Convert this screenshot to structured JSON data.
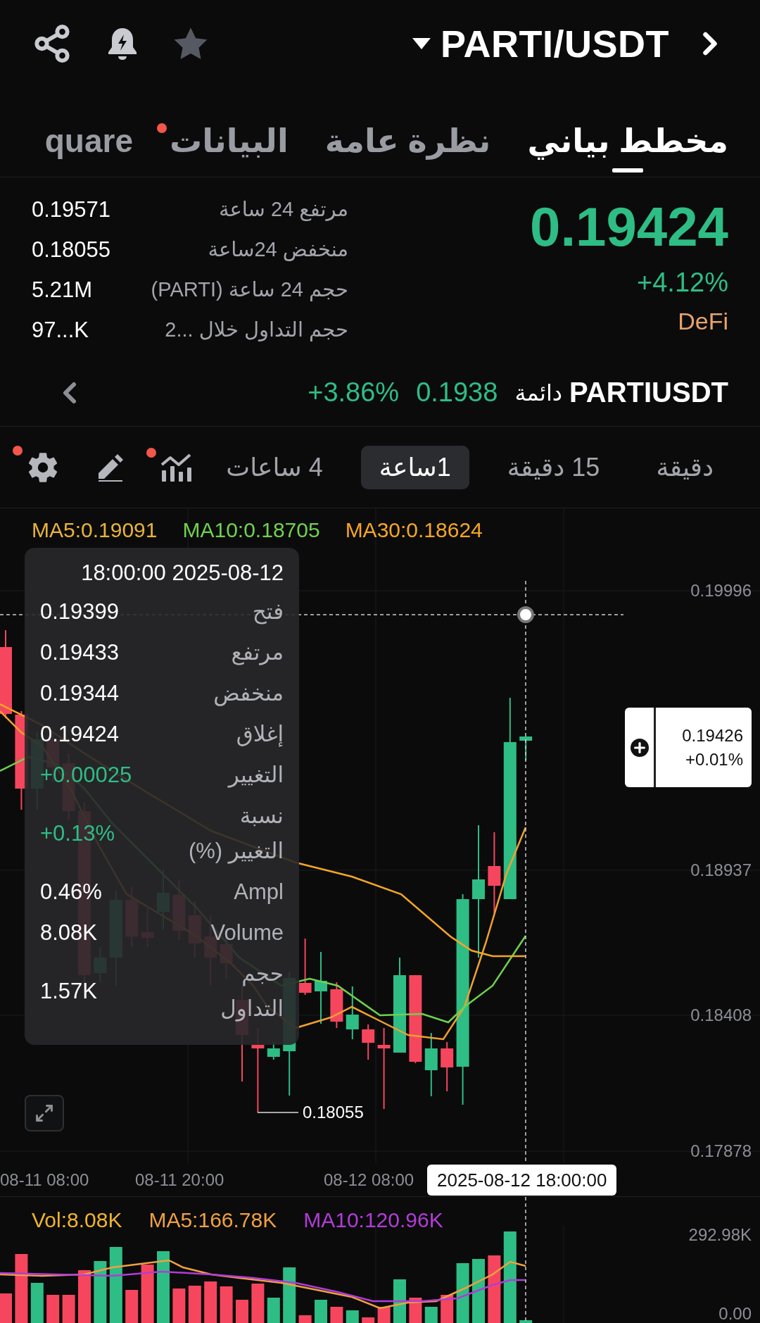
{
  "header": {
    "pair": "PARTI/USDT"
  },
  "tabs": [
    {
      "label": "مخطط بياني",
      "selected": true,
      "dot": false
    },
    {
      "label": "نظرة عامة",
      "selected": false,
      "dot": false
    },
    {
      "label": "البيانات",
      "selected": false,
      "dot": true
    },
    {
      "label": "quare",
      "selected": false,
      "dot": false
    }
  ],
  "price": {
    "last": "0.19424",
    "change": "+4.12%",
    "sector": "DeFi"
  },
  "stats": [
    {
      "label": "مرتفع 24 ساعة",
      "value": "0.19571"
    },
    {
      "label": "منخفض 24ساعة",
      "value": "0.18055"
    },
    {
      "label": "حجم 24 ساعة (PARTI)",
      "value": "5.21M"
    },
    {
      "label": "حجم التداول خلال ...2",
      "value": "97...K"
    }
  ],
  "perpetual": {
    "symbol": "PARTIUSDT",
    "type": "دائمة",
    "price": "0.1938",
    "change": "+3.86%"
  },
  "timeframes": [
    {
      "label": "دقيقة",
      "selected": false
    },
    {
      "label": "15 دقيقة",
      "selected": false
    },
    {
      "label": "1ساعة",
      "selected": true
    },
    {
      "label": "4 ساعات",
      "selected": false
    }
  ],
  "tools": [
    {
      "kind": "indicators",
      "dot": true
    },
    {
      "kind": "draw",
      "dot": false
    },
    {
      "kind": "settings",
      "dot": true
    }
  ],
  "chart": {
    "legend": [
      {
        "text": "MA30:0.18624",
        "color": "#f5a623"
      },
      {
        "text": "MA10:0.18705",
        "color": "#6fd14f"
      },
      {
        "text": "MA5:0.19091",
        "color": "#e8b33a"
      }
    ],
    "price_axis": [
      "0.19996",
      "0.18937",
      "0.18408",
      "0.17878"
    ],
    "low_marker": "0.18055",
    "crosshair": {
      "price": "0.19426",
      "change": "+0.01%",
      "time": "2025-08-12 18:00:00"
    },
    "time_axis": [
      "08-12 08:00",
      "08-11 20:00",
      "08-11 08:00"
    ],
    "tooltip": {
      "title": "18:00:00 2025-08-12",
      "rows": [
        {
          "label": "فتح",
          "value": "0.19399",
          "kind": "plain"
        },
        {
          "label": "مرتفع",
          "value": "0.19433",
          "kind": "plain"
        },
        {
          "label": "منخفض",
          "value": "0.19344",
          "kind": "plain"
        },
        {
          "label": "إغلاق",
          "value": "0.19424",
          "kind": "plain"
        },
        {
          "label": "التغيير",
          "value": "+0.00025",
          "kind": "change"
        },
        {
          "label": "نسبة التغيير (%)",
          "value": "+0.13%",
          "kind": "change"
        },
        {
          "label": "Ampl",
          "value": "0.46%",
          "kind": "plain"
        },
        {
          "label": "Volume",
          "value": "8.08K",
          "kind": "plain"
        },
        {
          "label": "حجم التداول",
          "value": "1.57K",
          "kind": "plain"
        }
      ]
    }
  },
  "volume": {
    "legend": [
      {
        "text": "MA10:120.96K",
        "color": "#b23cd8"
      },
      {
        "text": "MA5:166.78K",
        "color": "#f0a040"
      },
      {
        "text": "Vol:8.08K",
        "color": "#f0b429"
      }
    ],
    "axis": [
      "292.98K",
      "0.00"
    ]
  }
}
